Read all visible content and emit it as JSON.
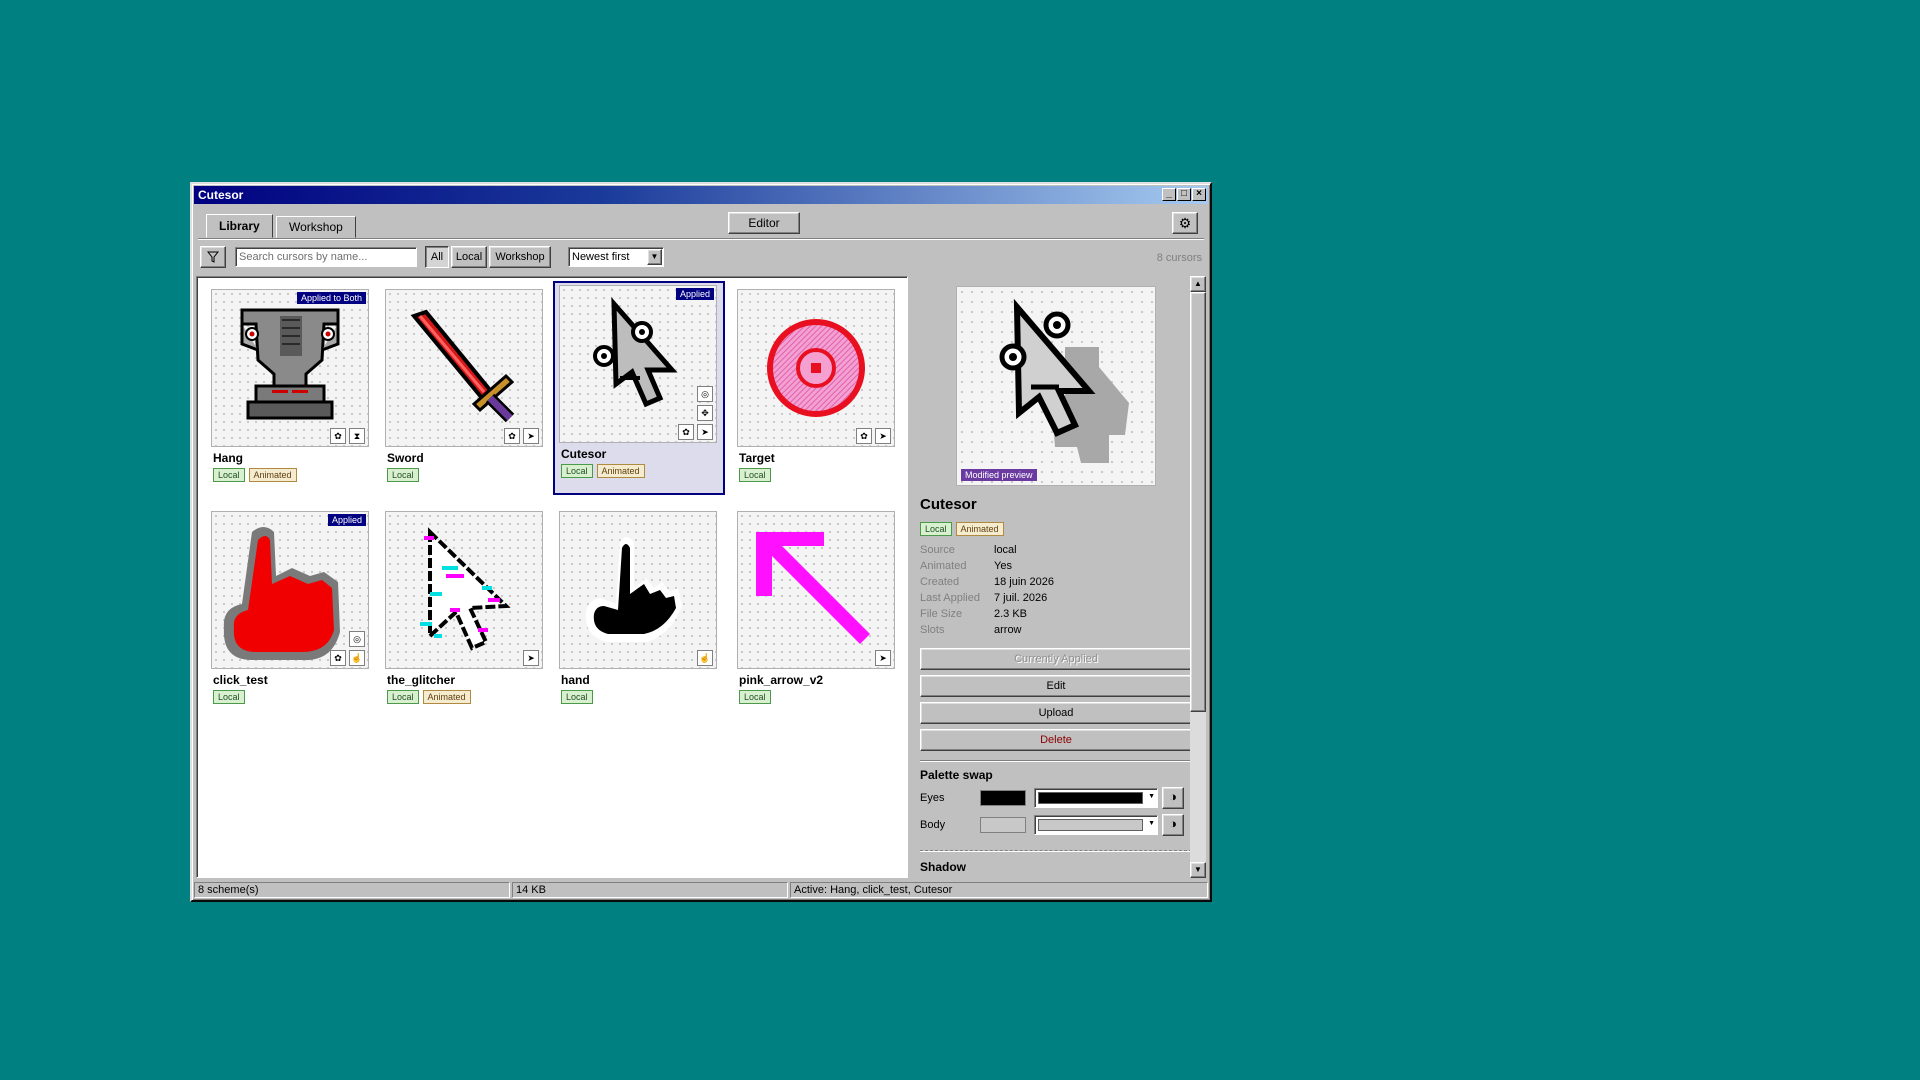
{
  "window": {
    "title": "Cutesor"
  },
  "tabs": [
    {
      "label": "Library"
    },
    {
      "label": "Workshop"
    }
  ],
  "header": {
    "editor_label": "Editor",
    "settings_icon": "gear-icon"
  },
  "toolbar": {
    "search_placeholder": "Search cursors by name...",
    "filters": [
      "All",
      "Local",
      "Workshop"
    ],
    "active_filter": "All",
    "sort_value": "Newest first",
    "count_label": "8 cursors"
  },
  "cursors": [
    {
      "name": "Hang",
      "badge": "Applied to Both",
      "tags": [
        "Local",
        "Animated"
      ],
      "icons": [
        "palette-icon",
        "hourglass-icon"
      ]
    },
    {
      "name": "Sword",
      "badge": "",
      "tags": [
        "Local"
      ],
      "icons": [
        "palette-icon",
        "arrow-pointer-icon"
      ]
    },
    {
      "name": "Cutesor",
      "badge": "Applied",
      "tags": [
        "Local",
        "Animated"
      ],
      "icons": [
        "target-icon",
        "move-icon",
        "palette-icon",
        "arrow-pointer-icon"
      ],
      "selected": true
    },
    {
      "name": "Target",
      "badge": "",
      "tags": [
        "Local"
      ],
      "icons": [
        "palette-icon",
        "arrow-pointer-icon"
      ]
    },
    {
      "name": "click_test",
      "badge": "Applied",
      "tags": [
        "Local"
      ],
      "icons": [
        "target-icon",
        "palette-icon",
        "hand-icon"
      ]
    },
    {
      "name": "the_glitcher",
      "badge": "",
      "tags": [
        "Local",
        "Animated"
      ],
      "icons": [
        "arrow-pointer-icon"
      ]
    },
    {
      "name": "hand",
      "badge": "",
      "tags": [
        "Local"
      ],
      "icons": [
        "hand-icon"
      ]
    },
    {
      "name": "pink_arrow_v2",
      "badge": "",
      "tags": [
        "Local"
      ],
      "icons": [
        "arrow-pointer-icon"
      ]
    }
  ],
  "details": {
    "name": "Cutesor",
    "preview_badge": "Modified preview",
    "tags": [
      "Local",
      "Animated"
    ],
    "meta": [
      {
        "key": "Source",
        "value": "local"
      },
      {
        "key": "Animated",
        "value": "Yes"
      },
      {
        "key": "Created",
        "value": "18 juin 2026"
      },
      {
        "key": "Last Applied",
        "value": "7 juil. 2026"
      },
      {
        "key": "File Size",
        "value": "2.3 KB"
      },
      {
        "key": "Slots",
        "value": "arrow"
      }
    ],
    "actions": {
      "applied": "Currently Applied",
      "edit": "Edit",
      "upload": "Upload",
      "delete": "Delete"
    },
    "palette_title": "Palette swap",
    "palette": [
      {
        "label": "Eyes",
        "color": "#000000"
      },
      {
        "label": "Body",
        "color": "#c8c8c8"
      }
    ],
    "next_section": "Shadow"
  },
  "status": {
    "schemes": "8 scheme(s)",
    "size": "14 KB",
    "active": "Active: Hang, click_test, Cutesor"
  },
  "colors": {
    "desktop": "#008080",
    "title_start": "#000080",
    "accent": "#000080"
  }
}
